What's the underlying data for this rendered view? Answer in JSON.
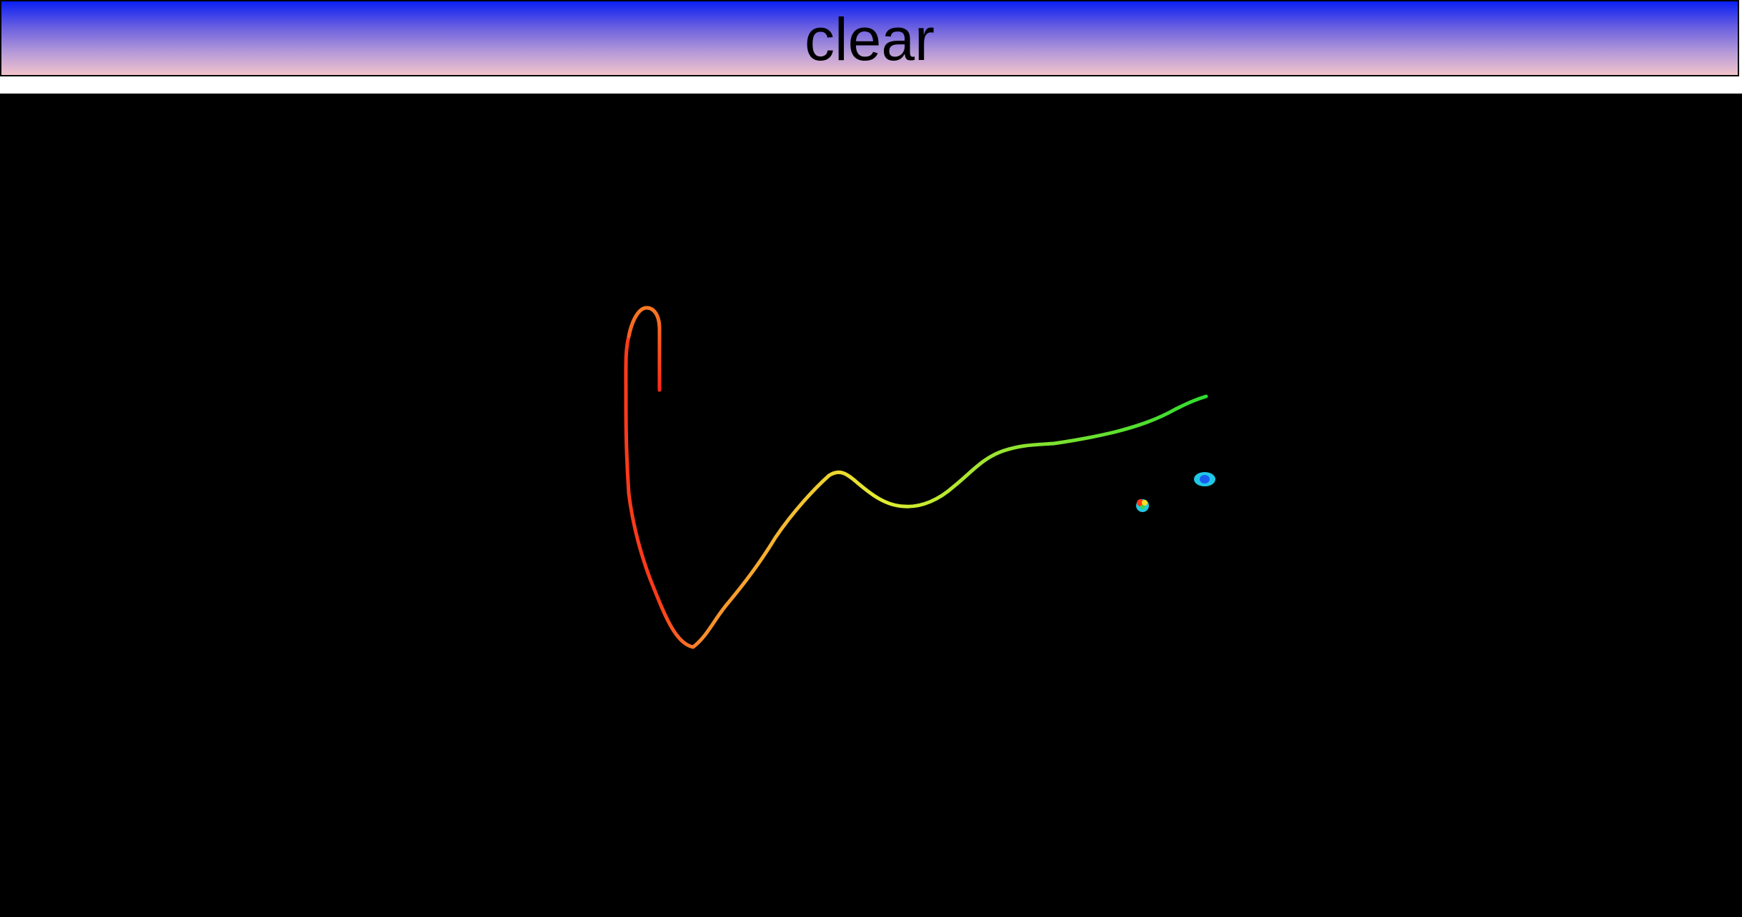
{
  "toolbar": {
    "clear_label": "clear",
    "gradient_top": "#0a1ff2",
    "gradient_bottom": "#f2c3cc"
  },
  "canvas": {
    "background": "#000000",
    "stroke_color_start": "#ff2a1a",
    "stroke_color_mid": "#ffee33",
    "stroke_color_end": "#33dd33"
  }
}
